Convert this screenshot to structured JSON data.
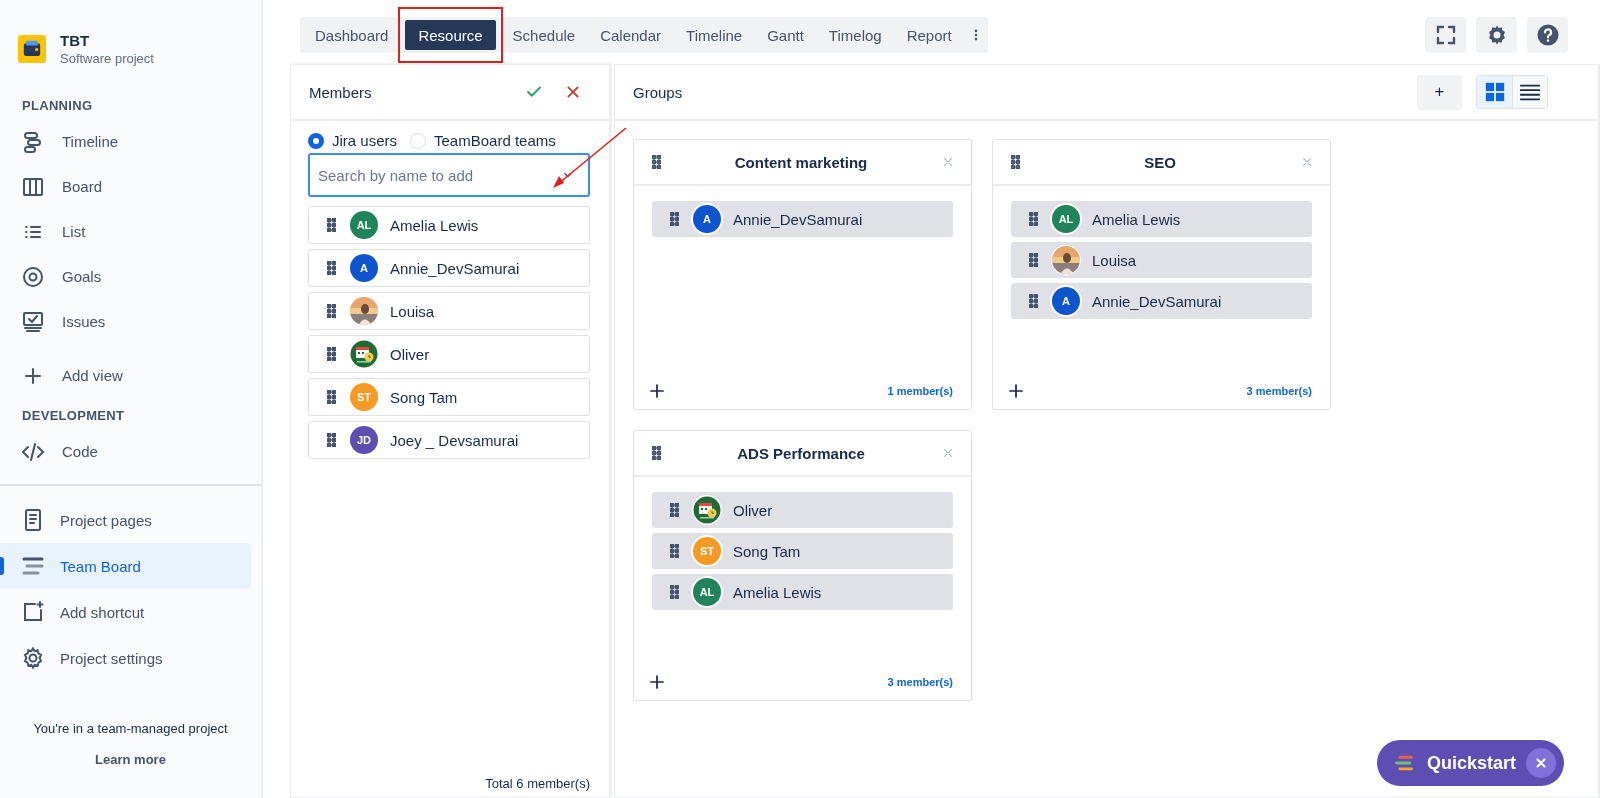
{
  "project": {
    "name": "TBT",
    "subtitle": "Software project"
  },
  "sidebar": {
    "sections": [
      {
        "title": "PLANNING",
        "items": [
          {
            "label": "Timeline",
            "selected": false
          },
          {
            "label": "Board",
            "selected": false
          },
          {
            "label": "List",
            "selected": false
          },
          {
            "label": "Goals",
            "selected": false
          },
          {
            "label": "Issues",
            "selected": false
          },
          {
            "label": "Add view",
            "selected": false
          }
        ]
      },
      {
        "title": "DEVELOPMENT",
        "items": [
          {
            "label": "Code",
            "selected": false
          }
        ]
      }
    ],
    "bottom_items": [
      {
        "label": "Project pages",
        "selected": false
      },
      {
        "label": "Team Board",
        "selected": true
      },
      {
        "label": "Add shortcut",
        "selected": false
      },
      {
        "label": "Project settings",
        "selected": false
      }
    ],
    "footer_text": "You're in a team-managed project",
    "footer_link": "Learn more"
  },
  "tabs": [
    {
      "label": "Dashboard",
      "selected": false
    },
    {
      "label": "Resource",
      "selected": true
    },
    {
      "label": "Schedule",
      "selected": false
    },
    {
      "label": "Calendar",
      "selected": false
    },
    {
      "label": "Timeline",
      "selected": false
    },
    {
      "label": "Gantt",
      "selected": false
    },
    {
      "label": "Timelog",
      "selected": false
    },
    {
      "label": "Report",
      "selected": false
    }
  ],
  "members_panel": {
    "title": "Members",
    "sources": [
      {
        "label": "Jira users",
        "selected": true
      },
      {
        "label": "TeamBoard teams",
        "selected": false
      }
    ],
    "search": {
      "placeholder": "Search by name to add"
    },
    "members": [
      {
        "name": "Amelia Lewis",
        "avatar": {
          "kind": "initials",
          "initials": "AL",
          "color": "#1f845a"
        }
      },
      {
        "name": "Annie_DevSamurai",
        "avatar": {
          "kind": "initials",
          "initials": "A",
          "color": "#0c55cf"
        }
      },
      {
        "name": "Louisa"
      },
      {
        "name": "Oliver",
        "avatar": {
          "kind": "logo"
        }
      },
      {
        "name": "Song Tam",
        "avatar": {
          "kind": "initials",
          "initials": "ST",
          "color": "#f79a23"
        }
      },
      {
        "name": "Joey _ Devsamurai",
        "avatar": {
          "kind": "initials",
          "initials": "JD",
          "color": "#5e4db2"
        }
      }
    ],
    "total": "Total 6 member(s)"
  },
  "groups_panel": {
    "title": "Groups",
    "add_label": "+",
    "view_toggle": [
      {
        "selected": true
      },
      {
        "selected": false
      }
    ],
    "groups": [
      {
        "name": "Content marketing",
        "count": "1 member(s)",
        "members": [
          {
            "name": "Annie_DevSamurai",
            "avatar": {
              "kind": "initials",
              "initials": "A",
              "color": "#0c55cf"
            }
          }
        ]
      },
      {
        "name": "SEO",
        "count": "3 member(s)",
        "members": [
          {
            "name": "Amelia Lewis",
            "avatar": {
              "kind": "initials",
              "initials": "AL",
              "color": "#1f845a"
            }
          },
          {
            "name": "Louisa"
          },
          {
            "name": "Annie_DevSamurai",
            "avatar": {
              "kind": "initials",
              "initials": "A",
              "color": "#0c55cf"
            }
          }
        ]
      },
      {
        "name": "ADS Performance",
        "count": "3 member(s)",
        "members": [
          {
            "name": "Oliver",
            "avatar": {
              "kind": "logo"
            }
          },
          {
            "name": "Song Tam",
            "avatar": {
              "kind": "initials",
              "initials": "ST",
              "color": "#f79a23"
            }
          },
          {
            "name": "Amelia Lewis",
            "avatar": {
              "kind": "initials",
              "initials": "AL",
              "color": "#1f845a"
            }
          }
        ]
      }
    ]
  },
  "quickstart": {
    "label": "Quickstart"
  }
}
